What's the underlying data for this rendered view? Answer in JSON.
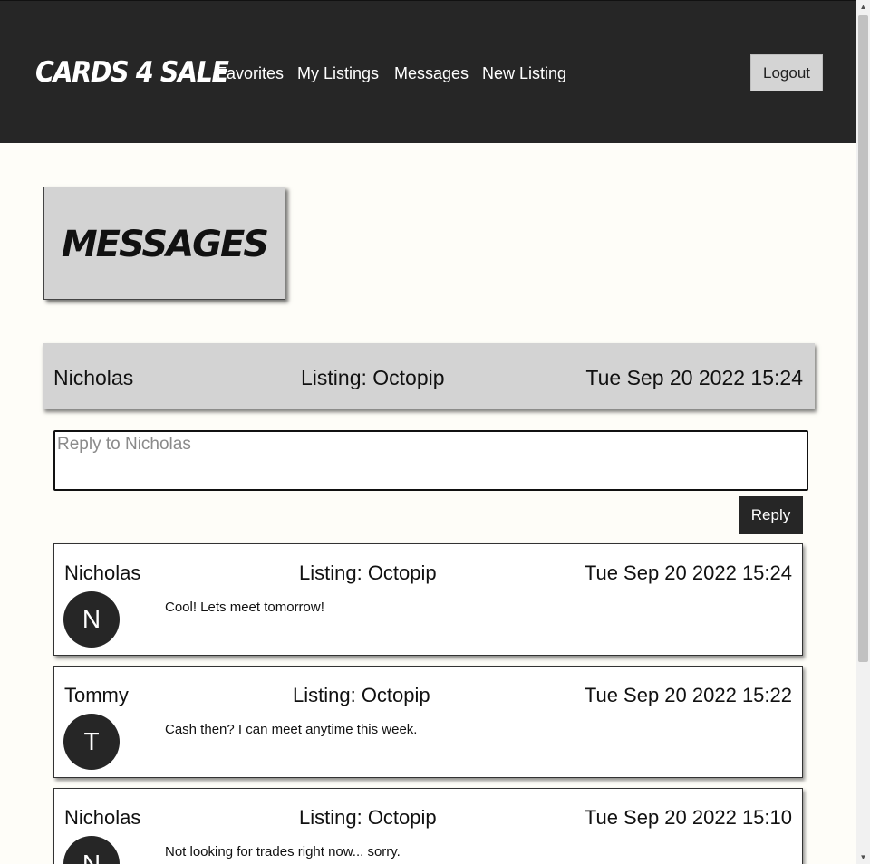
{
  "header": {
    "logo": "CARDS 4 SALE",
    "nav": [
      "Favorites",
      "My Listings",
      "Messages",
      "New Listing"
    ],
    "logout_label": "Logout"
  },
  "page_title": "MESSAGES",
  "thread": {
    "name": "Nicholas",
    "listing": "Listing: Octopip",
    "date": "Tue Sep 20 2022 15:24"
  },
  "reply": {
    "placeholder": "Reply to Nicholas",
    "value": "",
    "button_label": "Reply"
  },
  "messages": [
    {
      "name": "Nicholas",
      "listing": "Listing: Octopip",
      "date": "Tue Sep 20 2022 15:24",
      "initial": "N",
      "body": "Cool! Lets meet tomorrow!"
    },
    {
      "name": "Tommy",
      "listing": "Listing: Octopip",
      "date": "Tue Sep 20 2022 15:22",
      "initial": "T",
      "body": "Cash then? I can meet anytime this week."
    },
    {
      "name": "Nicholas",
      "listing": "Listing: Octopip",
      "date": "Tue Sep 20 2022 15:10",
      "initial": "N",
      "body": "Not looking for trades right now... sorry."
    }
  ],
  "colors": {
    "header_bg": "#262626",
    "page_bg": "#fefdf8",
    "card_bg": "#d3d3d3",
    "button_dark": "#262626"
  }
}
